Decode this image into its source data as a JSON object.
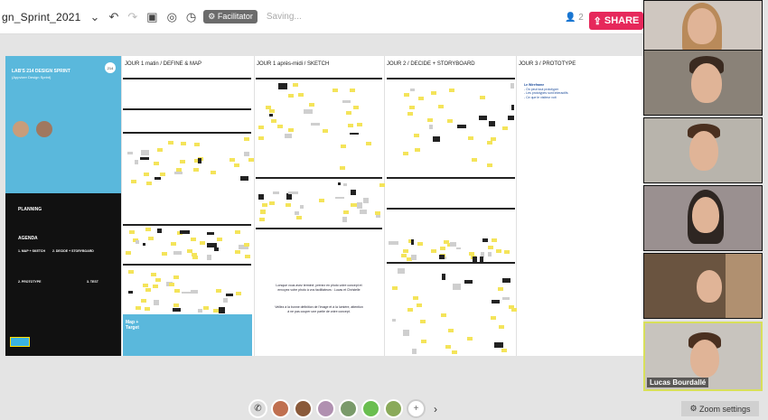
{
  "app": {
    "title": "gn_Sprint_2021",
    "facilitator_label": "Facilitator",
    "saving_label": "Saving...",
    "user_count": "2",
    "share_label": "SHARE"
  },
  "board": {
    "intro_title": "LAB'S 214 DESIGN SPRINT",
    "intro_subtitle": "(Appvizer Design Sprint)",
    "badge": "214",
    "planning_title": "PLANNING",
    "agenda_title": "AGENDA",
    "agenda_items": [
      "1. MAP + SKETCH",
      "2. DECIDE + STORYBOARD",
      "2. PROTOTYPE",
      "3. TEST"
    ],
    "map_target_label": "Map + Target",
    "columns": [
      "JOUR 1 matin / DEFINE & MAP",
      "JOUR 1 après-midi / SKETCH",
      "JOUR 2 / DECIDE + STORYBOARD",
      "JOUR 3 / PROTOTYPE"
    ],
    "sketch_note": "Lorsque vous avez terminé, prenez en photo votre concept et envoyez votre photo à vos facilitateurs : Lucas et Christelle",
    "sketch_note_2": "Veillez à la bonne définition de l'image et à la lumière, attention à ne pas couper une partie de votre concept.",
    "prototype_heading": "Le Wireframe",
    "prototype_lines": [
      "- On peut tout prototyper",
      "- Les prototypes sont interactifs",
      "- Ce que le visiteur voit"
    ]
  },
  "video": {
    "active_participant": "Lucas Bourdallé",
    "zoom_settings_label": "Zoom settings"
  },
  "colors": {
    "share": "#e6285b",
    "intro_blue": "#5ab8dc",
    "sticky_yellow": "#f4e45a",
    "active_border": "#d8e05a"
  }
}
